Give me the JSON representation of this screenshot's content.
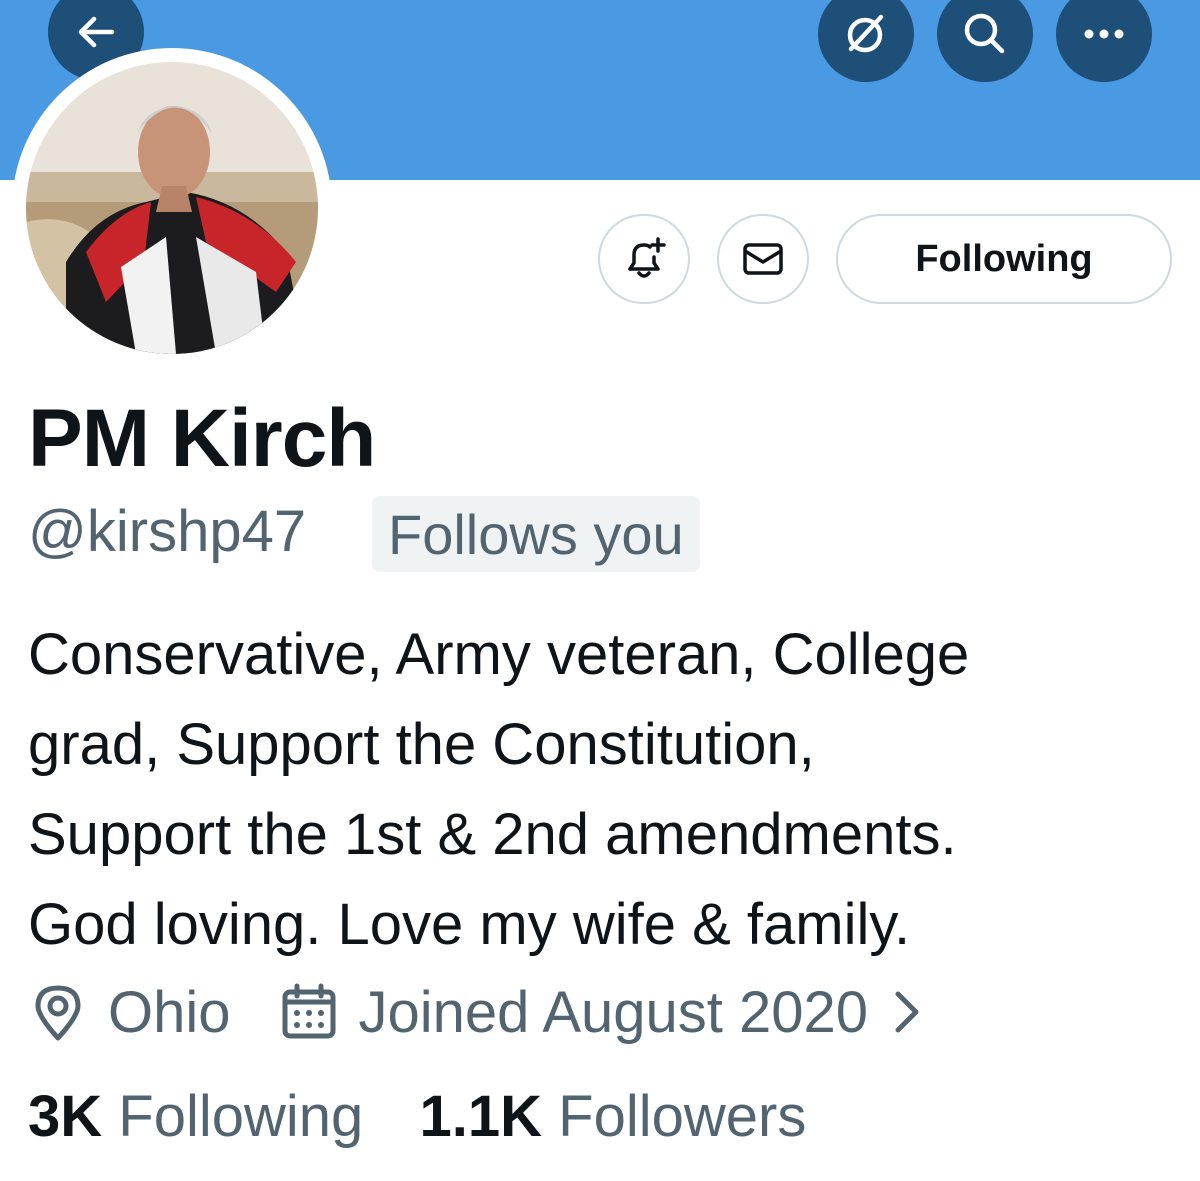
{
  "header": {
    "back_icon": "arrow-left-icon",
    "grok_icon": "circle-slash-icon",
    "search_icon": "search-icon",
    "more_icon": "more-dots-icon",
    "banner_color": "#4a99e3"
  },
  "actions": {
    "notify_icon": "bell-plus-icon",
    "message_icon": "envelope-icon",
    "following_label": "Following"
  },
  "profile": {
    "name": "PM Kirch",
    "handle": "@kirshp47",
    "follows_you": "Follows you",
    "bio_lines": [
      "Conservative, Army veteran, College",
      "grad, Support the Constitution,",
      "Support the 1st & 2nd amendments.",
      "God loving. Love my wife & family."
    ],
    "location": "Ohio",
    "joined": "Joined August 2020",
    "following_count": "3K",
    "following_label": "Following",
    "followers_count": "1.1K",
    "followers_label": "Followers"
  }
}
